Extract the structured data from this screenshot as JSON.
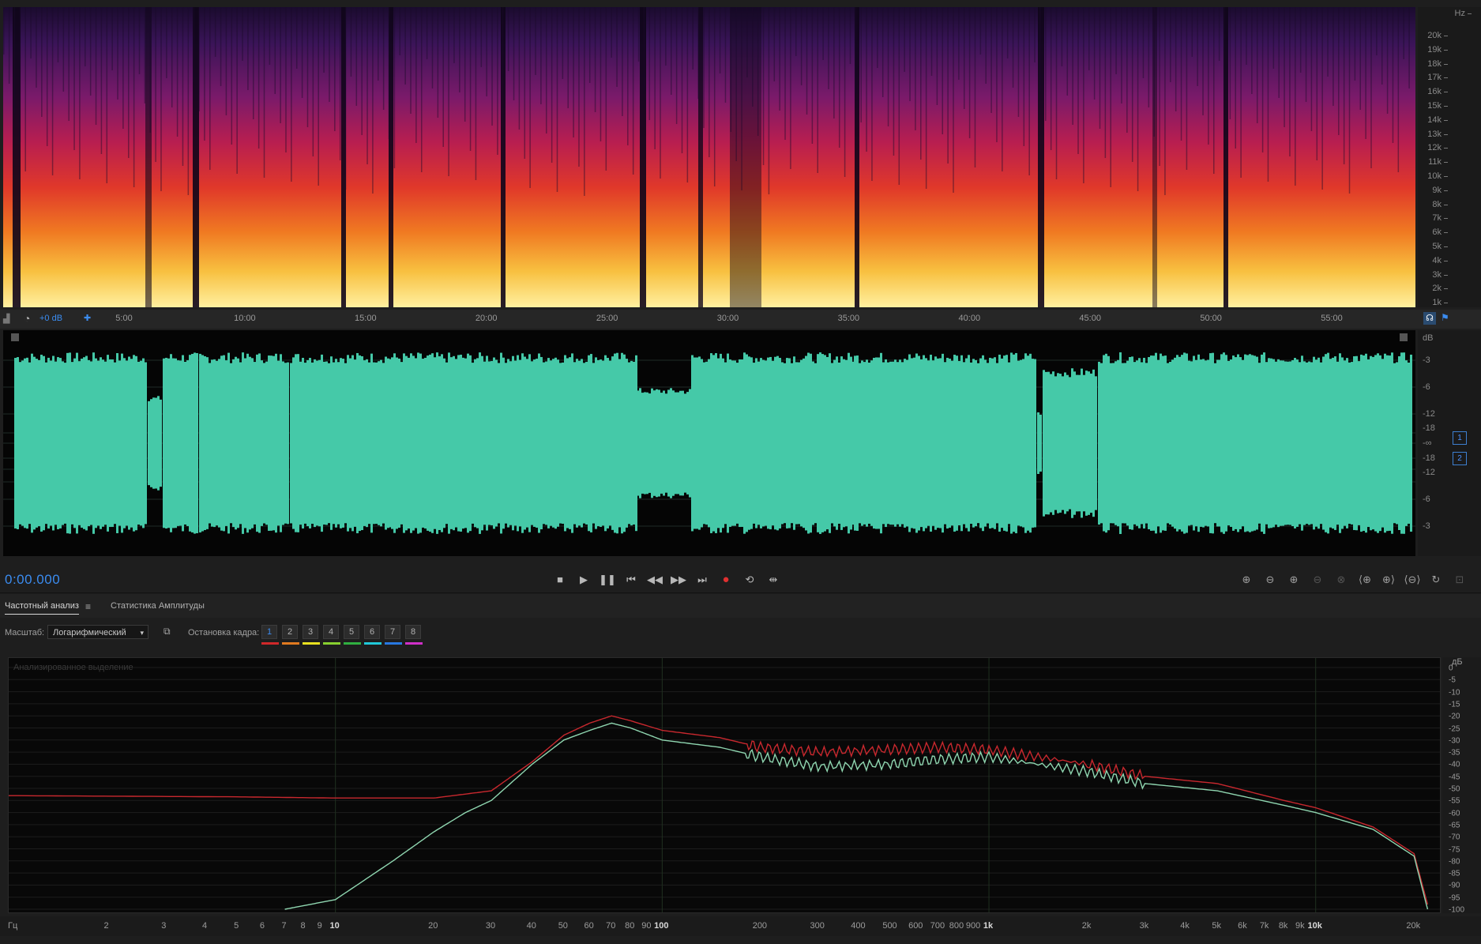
{
  "colors": {
    "accent": "#3b8cf0",
    "waveform": "#45c9a8",
    "channel_red": "#c8282e",
    "channel_green": "#8fd6b0"
  },
  "spectrogram": {
    "unit": "Hz",
    "ticks": [
      "20k",
      "19k",
      "18k",
      "17k",
      "16k",
      "15k",
      "14k",
      "13k",
      "12k",
      "11k",
      "10k",
      "9k",
      "8k",
      "7k",
      "6k",
      "5k",
      "4k",
      "3k",
      "2k",
      "1k"
    ]
  },
  "timeline": {
    "level_label": "+0 dB",
    "ticks": [
      "5:00",
      "10:00",
      "15:00",
      "20:00",
      "25:00",
      "30:00",
      "35:00",
      "40:00",
      "45:00",
      "50:00",
      "55:00"
    ]
  },
  "waveform": {
    "unit": "dB",
    "ticks_top": [
      "-3",
      "-6",
      "-12",
      "-18",
      "-∞"
    ],
    "ticks_bottom": [
      "-18",
      "-12",
      "-6",
      "-3"
    ],
    "channels": [
      "1",
      "2"
    ]
  },
  "transport": {
    "timecode": "0:00.000",
    "icons": [
      "stop-icon",
      "play-icon",
      "pause-icon",
      "skip-start-icon",
      "rewind-icon",
      "fast-forward-icon",
      "skip-end-icon",
      "record-icon",
      "loop-icon",
      "skip-selection-icon"
    ],
    "zoom_icons": [
      "zoom-in-amplitude-icon",
      "zoom-out-amplitude-icon",
      "zoom-in-time-icon",
      "zoom-out-time-icon",
      "zoom-full-icon",
      "zoom-in-start-icon",
      "zoom-in-end-icon",
      "zoom-out-full-icon",
      "zoom-selection-icon",
      "zoom-reset-icon"
    ]
  },
  "analysis": {
    "tabs": [
      "Частотный анализ",
      "Статистика Амплитуды"
    ],
    "scale_label": "Масштаб:",
    "scale_value": "Логарифмический",
    "freeze_label": "Остановка кадра:",
    "freeze_buttons": [
      "1",
      "2",
      "3",
      "4",
      "5",
      "6",
      "7",
      "8"
    ],
    "freeze_colors": [
      "#d0282a",
      "#e07a20",
      "#e8e020",
      "#88d030",
      "#30b040",
      "#20c8d8",
      "#2878e0",
      "#d030c8"
    ],
    "overlay_text": "Анализированное выделение",
    "db_unit": "дБ",
    "db_ticks": [
      "0",
      "-5",
      "-10",
      "-15",
      "-20",
      "-25",
      "-30",
      "-35",
      "-40",
      "-45",
      "-50",
      "-55",
      "-60",
      "-65",
      "-70",
      "-75",
      "-80",
      "-85",
      "-90",
      "-95",
      "-100"
    ],
    "freq_unit": "Гц",
    "freq_ticks": [
      "2",
      "3",
      "4",
      "5",
      "6",
      "7",
      "8",
      "9",
      "10",
      "20",
      "30",
      "40",
      "50",
      "60",
      "70",
      "80",
      "90",
      "100",
      "200",
      "300",
      "400",
      "500",
      "600",
      "700",
      "800",
      "900",
      "1k",
      "2k",
      "3k",
      "4k",
      "5k",
      "6k",
      "7k",
      "8k",
      "9k",
      "10k",
      "20k"
    ]
  },
  "chart_data": {
    "type": "line",
    "xlabel": "Гц",
    "ylabel": "дБ",
    "x_scale": "log",
    "xlim": [
      1,
      24000
    ],
    "ylim": [
      -100,
      0
    ],
    "grid": true,
    "series": [
      {
        "color": "#c8282e",
        "x": [
          1,
          5,
          10,
          20,
          30,
          40,
          50,
          60,
          70,
          80,
          100,
          150,
          200,
          300,
          500,
          700,
          1000,
          2000,
          3000,
          5000,
          8000,
          10000,
          15000,
          20000,
          22000
        ],
        "y": [
          -53,
          -53.5,
          -54,
          -54,
          -51,
          -39,
          -28,
          -23,
          -20,
          -22,
          -26,
          -29,
          -33,
          -35,
          -34,
          -33,
          -34,
          -40,
          -45,
          -48,
          -55,
          -58,
          -66,
          -77,
          -98
        ]
      },
      {
        "color": "#8fd6b0",
        "x": [
          7,
          10,
          15,
          20,
          25,
          30,
          40,
          50,
          60,
          70,
          80,
          100,
          150,
          200,
          300,
          500,
          700,
          1000,
          2000,
          3000,
          5000,
          8000,
          10000,
          15000,
          20000,
          22000
        ],
        "y": [
          -100,
          -96,
          -80,
          -68,
          -60,
          -55,
          -40,
          -30,
          -26,
          -23,
          -25,
          -30,
          -33,
          -37,
          -41,
          -40,
          -38,
          -37,
          -43,
          -48,
          -51,
          -57,
          -60,
          -67,
          -78,
          -100
        ]
      }
    ]
  }
}
